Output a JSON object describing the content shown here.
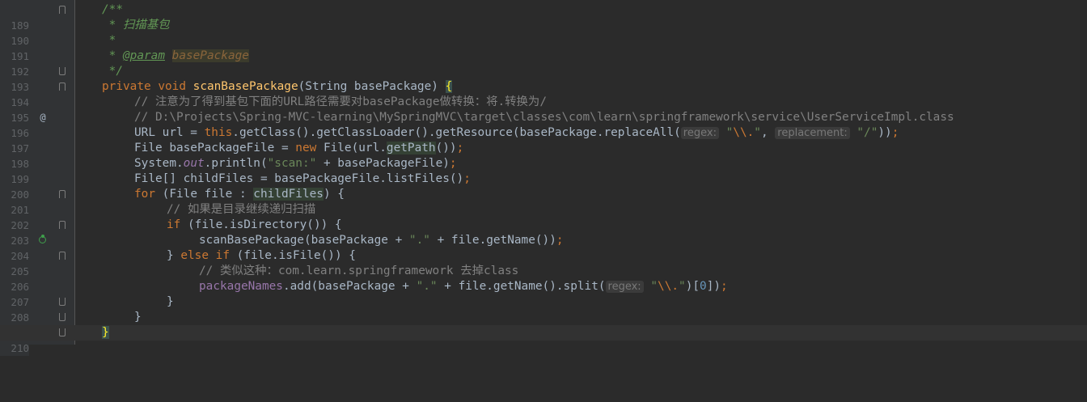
{
  "gutter": {
    "line_numbers": [
      "189",
      "190",
      "191",
      "192",
      "193",
      "194",
      "195",
      "196",
      "197",
      "198",
      "199",
      "200",
      "201",
      "202",
      "203",
      "204",
      "205",
      "206",
      "207",
      "208",
      "209",
      "210"
    ],
    "markers": {
      "at_symbol": "@"
    }
  },
  "code": {
    "l189": {
      "text": "/**"
    },
    "l190": {
      "text": " * 扫描基包"
    },
    "l191": {
      "text": " *"
    },
    "l192": {
      "prefix": " * ",
      "tag": "@param",
      "param": "basePackage"
    },
    "l193": {
      "text": " */"
    },
    "l194": {
      "kw1": "private",
      "kw2": "void",
      "fn": "scanBasePackage",
      "args": "(String basePackage) ",
      "brace": "{"
    },
    "l195": {
      "text": "// 注意为了得到基包下面的URL路径需要对basePackage做转换：将.转换为/"
    },
    "l196": {
      "text": "// D:\\Projects\\Spring-MVC-learning\\MySpringMVC\\target\\classes\\com\\learn\\springframework\\service\\UserServiceImpl.class"
    },
    "l197": {
      "t1": "URL url = ",
      "kw": "this",
      "t2": ".getClass().getClassLoader().getResource(basePackage.replaceAll(",
      "hint1": "regex:",
      "s1a": "\"",
      "s1esc": "\\\\.",
      "s1b": "\"",
      "t3": ", ",
      "hint2": "replacement:",
      "s2": "\"/\"",
      "t4": "))",
      "semi": ";"
    },
    "l198": {
      "t1": "File basePackageFile = ",
      "kw": "new",
      "t2": " File(url.",
      "hl": "getPath",
      "t3": "())",
      "semi": ";"
    },
    "l199": {
      "t1": "System.",
      "static": "out",
      "t2": ".println(",
      "s": "\"scan:\"",
      "t3": " + basePackageFile)",
      "semi": ";"
    },
    "l200": {
      "t1": "File[] childFiles = basePackageFile.listFiles()",
      "semi": ";"
    },
    "l201": {
      "kw": "for",
      "t1": " (File file : ",
      "hl": "childFiles",
      "t2": ") {"
    },
    "l202": {
      "text": "// 如果是目录继续递归扫描"
    },
    "l203": {
      "kw": "if",
      "t1": " (file.isDirectory()) {"
    },
    "l204": {
      "t1": "scanBasePackage(basePackage + ",
      "s": "\".\"",
      "t2": " + file.getName())",
      "semi": ";"
    },
    "l205": {
      "t1": "} ",
      "kw1": "else",
      "t2": " ",
      "kw2": "if",
      "t3": " (file.isFile()) {"
    },
    "l206": {
      "text": "// 类似这种：com.learn.springframework 去掉class"
    },
    "l207": {
      "field": "packageNames",
      "t1": ".add(basePackage + ",
      "s1": "\".\"",
      "t2": " + file.getName().split(",
      "hint": "regex:",
      "s2a": "\"",
      "s2esc": "\\\\.",
      "s2b": "\"",
      "t3": ")[",
      "num": "0",
      "t4": "])",
      "semi": ";"
    },
    "l208": {
      "text": "}"
    },
    "l209": {
      "text": "}"
    },
    "l210": {
      "text": "}"
    }
  },
  "colors": {
    "background": "#2b2b2b",
    "gutter": "#313335",
    "keyword": "#cc7832",
    "method": "#ffc66d",
    "string": "#6a8759",
    "comment": "#808080",
    "doc_comment": "#629755",
    "field": "#9876aa",
    "plain": "#a9b7c6"
  }
}
